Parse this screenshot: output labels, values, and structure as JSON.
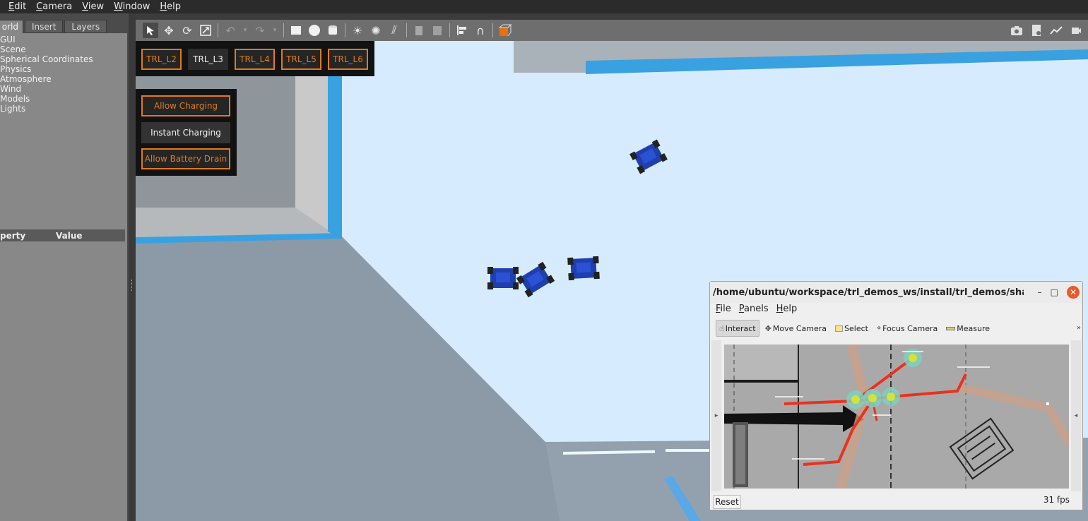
{
  "menubar": {
    "items": [
      "Edit",
      "Camera",
      "View",
      "Window",
      "Help"
    ]
  },
  "left_panel": {
    "tabs": [
      "orld",
      "Insert",
      "Layers"
    ],
    "tree": [
      "GUI",
      "Scene",
      "Spherical Coordinates",
      "Physics",
      "Atmosphere",
      "Wind",
      "Models",
      "Lights"
    ],
    "property_header": {
      "col1": "perty",
      "col2": "Value"
    }
  },
  "toolbar": {
    "icons": [
      "select-arrow",
      "translate",
      "rotate",
      "scale",
      "undo",
      "undo-history",
      "redo",
      "redo-history",
      "box",
      "sphere",
      "cylinder",
      "point-light",
      "spot-light",
      "directional-light",
      "copy",
      "paste",
      "align",
      "snap",
      "view-angle"
    ],
    "right_icons": [
      "screenshot",
      "record-log",
      "plot",
      "video-record"
    ]
  },
  "levels": {
    "buttons": [
      "TRL_L2",
      "TRL_L3",
      "TRL_L4",
      "TRL_L5",
      "TRL_L6"
    ],
    "active": "TRL_L3"
  },
  "charging": {
    "allow_charging": "Allow Charging",
    "instant_charging": "Instant Charging",
    "allow_battery_drain": "Allow Battery Drain"
  },
  "rviz": {
    "title": "/home/ubuntu/workspace/trl_demos_ws/install/trl_demos/share/trl_de...",
    "minimize": "–",
    "maximize": "□",
    "close": "✕",
    "menu": [
      "File",
      "Panels",
      "Help"
    ],
    "tools": [
      "Interact",
      "Move Camera",
      "Select",
      "Focus Camera",
      "Measure"
    ],
    "more": "»",
    "reset": "Reset",
    "fps": "31 fps"
  },
  "colors": {
    "accent_orange": "#e07b1a",
    "floor_blue": "#d6eaff",
    "robot_blue": "#1f3fae",
    "path_red": "#e8321f"
  }
}
